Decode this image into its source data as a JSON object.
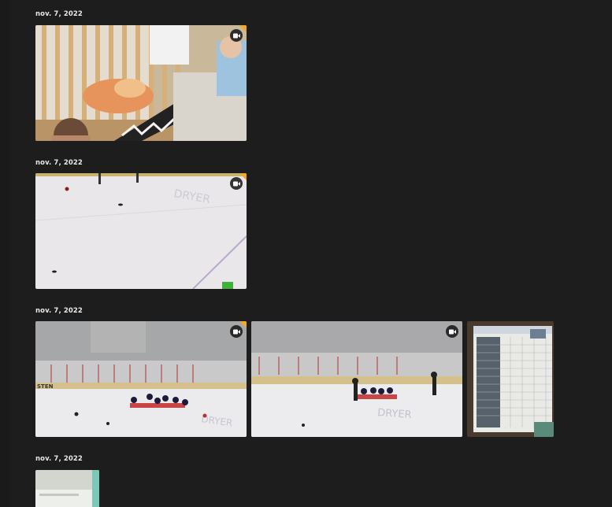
{
  "groups": [
    {
      "date": "nov. 7, 2022",
      "items": [
        {
          "kind": "video",
          "icon": "video-camera-icon",
          "scene": "crib-blanket"
        }
      ]
    },
    {
      "date": "nov. 7, 2022",
      "items": [
        {
          "kind": "video",
          "icon": "video-camera-icon",
          "scene": "ice-rink-closeup"
        }
      ]
    },
    {
      "date": "nov. 7, 2022",
      "items": [
        {
          "kind": "video",
          "icon": "video-camera-icon",
          "scene": "ice-rink-kids-sitting"
        },
        {
          "kind": "video",
          "icon": "video-camera-icon",
          "scene": "ice-rink-skaters"
        },
        {
          "kind": "photo",
          "scene": "schedule-board"
        }
      ]
    },
    {
      "date": "nov. 7, 2022",
      "items": [
        {
          "kind": "photo",
          "scene": "bathroom"
        }
      ]
    }
  ],
  "colors": {
    "background": "#1d1d1e",
    "date_text": "#e8e8e8",
    "badge_accent": "#f0a92b"
  }
}
